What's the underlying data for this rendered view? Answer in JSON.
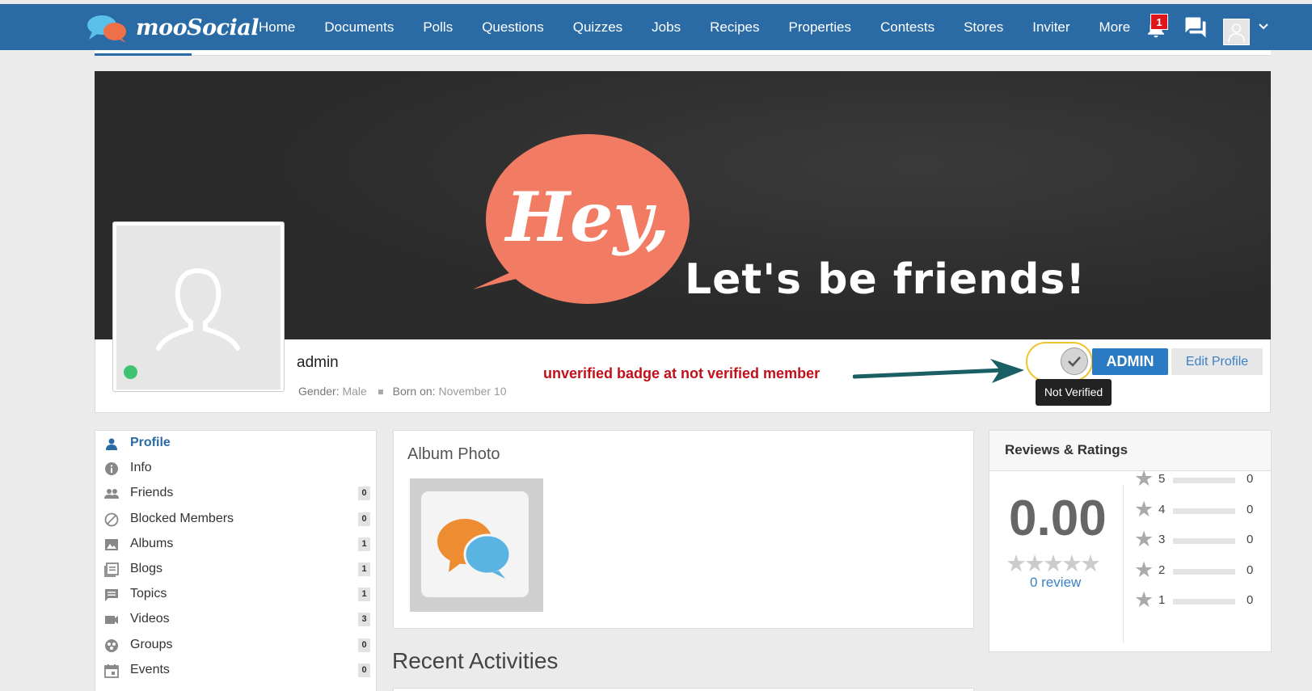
{
  "brand": {
    "name": "mooSocial"
  },
  "nav": {
    "items": [
      "Home",
      "Documents",
      "Polls",
      "Questions",
      "Quizzes",
      "Jobs",
      "Recipes",
      "Properties",
      "Contests",
      "Stores",
      "Inviter"
    ],
    "more_label": "More",
    "notification_count": "1"
  },
  "cover": {
    "text": "Let's be friends!",
    "bubble_text": "Hey,"
  },
  "profile": {
    "username": "admin",
    "gender_label": "Gender:",
    "gender_value": "Male",
    "born_label": "Born on:",
    "born_value": "November 10",
    "annotation": "unverified badge at not verified member",
    "tooltip": "Not Verified",
    "role_button": "ADMIN",
    "edit_button": "Edit Profile"
  },
  "menu": {
    "items": [
      {
        "label": "Profile",
        "icon": "user-icon",
        "active": true
      },
      {
        "label": "Info",
        "icon": "info-icon"
      },
      {
        "label": "Friends",
        "icon": "friends-icon",
        "count": "0"
      },
      {
        "label": "Blocked Members",
        "icon": "blocked-icon",
        "count": "0"
      },
      {
        "label": "Albums",
        "icon": "image-icon",
        "count": "1"
      },
      {
        "label": "Blogs",
        "icon": "blog-icon",
        "count": "1"
      },
      {
        "label": "Topics",
        "icon": "topic-icon",
        "count": "1"
      },
      {
        "label": "Videos",
        "icon": "video-icon",
        "count": "3"
      },
      {
        "label": "Groups",
        "icon": "group-icon",
        "count": "0"
      },
      {
        "label": "Events",
        "icon": "calendar-icon",
        "count": "0"
      }
    ]
  },
  "album": {
    "title": "Album Photo"
  },
  "recent": {
    "title": "Recent Activities"
  },
  "reviews": {
    "title": "Reviews & Ratings",
    "score": "0.00",
    "review_link": "0 review",
    "breakdown": [
      {
        "stars": "5",
        "count": "0"
      },
      {
        "stars": "4",
        "count": "0"
      },
      {
        "stars": "3",
        "count": "0"
      },
      {
        "stars": "2",
        "count": "0"
      },
      {
        "stars": "1",
        "count": "0"
      }
    ]
  },
  "colors": {
    "primary": "#2a6ba5",
    "accent_red": "#c0101a",
    "online": "#3fc373",
    "highlight": "#f2c42c"
  }
}
